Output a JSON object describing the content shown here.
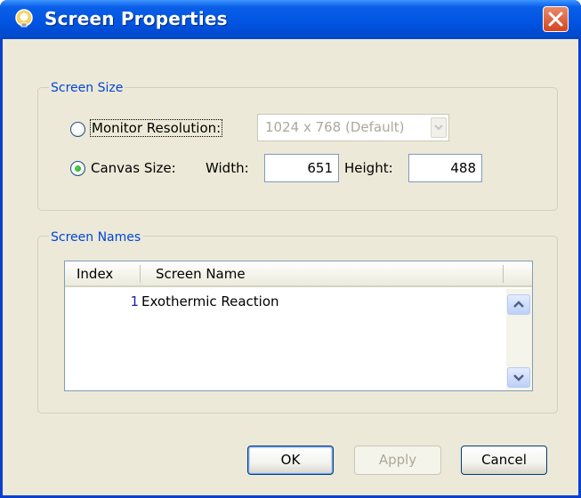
{
  "window": {
    "title": "Screen Properties"
  },
  "screen_size": {
    "legend": "Screen Size",
    "monitor_resolution": {
      "label": "Monitor Resolution:",
      "selected": false,
      "dropdown_value": "1024 x 768 (Default)"
    },
    "canvas_size": {
      "label": "Canvas Size:",
      "selected": true,
      "width_label": "Width:",
      "width_value": "651",
      "height_label": "Height:",
      "height_value": "488"
    }
  },
  "screen_names": {
    "legend": "Screen Names",
    "columns": [
      "Index",
      "Screen Name"
    ],
    "rows": [
      {
        "index": "1",
        "name": "Exothermic Reaction"
      }
    ]
  },
  "buttons": {
    "ok": "OK",
    "apply": "Apply",
    "cancel": "Cancel"
  },
  "icons": {
    "app": "lightbulb-app-icon",
    "close": "close-icon"
  }
}
